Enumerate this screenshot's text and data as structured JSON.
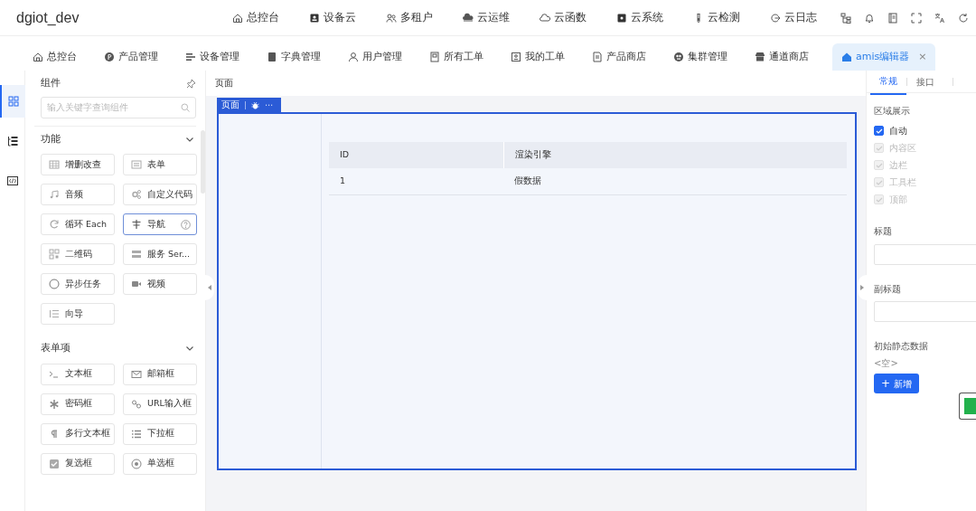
{
  "app": {
    "title": "dgiot_dev"
  },
  "top_nav": [
    {
      "label": "总控台"
    },
    {
      "label": "设备云"
    },
    {
      "label": "多租户"
    },
    {
      "label": "云运维"
    },
    {
      "label": "云函数"
    },
    {
      "label": "云系统"
    },
    {
      "label": "云检测"
    },
    {
      "label": "云日志"
    }
  ],
  "tabs": [
    {
      "label": "总控台",
      "selected": false,
      "closable": false
    },
    {
      "label": "产品管理",
      "selected": false,
      "closable": false
    },
    {
      "label": "设备管理",
      "selected": false,
      "closable": false
    },
    {
      "label": "字典管理",
      "selected": false,
      "closable": false
    },
    {
      "label": "用户管理",
      "selected": false,
      "closable": false
    },
    {
      "label": "所有工单",
      "selected": false,
      "closable": false
    },
    {
      "label": "我的工单",
      "selected": false,
      "closable": false
    },
    {
      "label": "产品商店",
      "selected": false,
      "closable": false
    },
    {
      "label": "集群管理",
      "selected": false,
      "closable": false
    },
    {
      "label": "通道商店",
      "selected": false,
      "closable": false
    },
    {
      "label": "amis编辑器",
      "selected": true,
      "closable": true,
      "close_glyph": "×"
    }
  ],
  "rail": [
    {
      "selected": true
    },
    {
      "selected": false
    },
    {
      "selected": false
    }
  ],
  "components_panel": {
    "title": "组件",
    "search": {
      "placeholder": "输入关键字查询组件"
    },
    "sections": [
      {
        "title": "功能",
        "expanded": true,
        "items": [
          {
            "label": "增删改查",
            "selected": false
          },
          {
            "label": "表单",
            "selected": false
          },
          {
            "label": "音频",
            "selected": false
          },
          {
            "label": "自定义代码",
            "selected": false
          },
          {
            "label": "循环 Each",
            "selected": false
          },
          {
            "label": "导航",
            "selected": true
          },
          {
            "label": "二维码",
            "selected": false
          },
          {
            "label": "服务 Ser...",
            "selected": false
          },
          {
            "label": "异步任务",
            "selected": false
          },
          {
            "label": "视频",
            "selected": false
          },
          {
            "label": "向导",
            "selected": false
          }
        ]
      },
      {
        "title": "表单项",
        "expanded": true,
        "items": [
          {
            "label": "文本框",
            "selected": false
          },
          {
            "label": "邮箱框",
            "selected": false
          },
          {
            "label": "密码框",
            "selected": false
          },
          {
            "label": "URL输入框",
            "selected": false
          },
          {
            "label": "多行文本框",
            "selected": false
          },
          {
            "label": "下拉框",
            "selected": false
          },
          {
            "label": "复选框",
            "selected": false
          },
          {
            "label": "单选框",
            "selected": false
          }
        ]
      }
    ]
  },
  "canvas": {
    "breadcrumb": "页面",
    "tag": {
      "label": "页面",
      "more": "⋯"
    },
    "table": {
      "columns": [
        "ID",
        "渲染引擎"
      ],
      "rows": [
        [
          "1",
          "假数据"
        ]
      ]
    }
  },
  "settings_panel": {
    "tabs": [
      {
        "label": "常规",
        "selected": true
      },
      {
        "label": "接口",
        "selected": false
      }
    ],
    "region_label": "区域展示",
    "regions": [
      {
        "label": "自动",
        "checked": true,
        "disabled": false
      },
      {
        "label": "内容区",
        "checked": true,
        "disabled": true
      },
      {
        "label": "边栏",
        "checked": true,
        "disabled": true
      },
      {
        "label": "工具栏",
        "checked": true,
        "disabled": true
      },
      {
        "label": "顶部",
        "checked": true,
        "disabled": true
      }
    ],
    "fields": [
      {
        "label": "标题"
      },
      {
        "label": "副标题"
      }
    ],
    "static_data": {
      "label": "初始静态数据",
      "empty": "<空>",
      "add_button": "新增",
      "add_glyph": "+"
    }
  }
}
